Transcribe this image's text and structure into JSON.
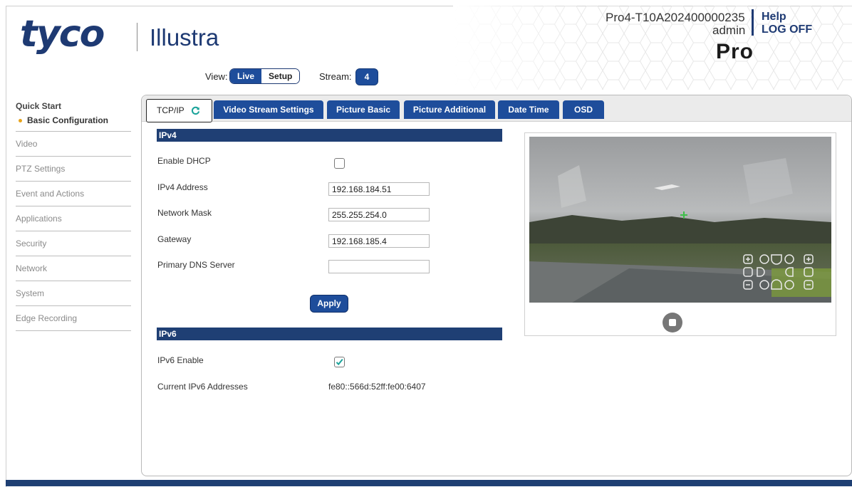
{
  "brand": {
    "logo_text": "tyco",
    "product_name": "Illustra",
    "model_label": "Pro"
  },
  "header": {
    "device_serial": "Pro4-T10A202400000235",
    "username": "admin",
    "help_label": "Help",
    "logoff_label": "LOG OFF"
  },
  "view_bar": {
    "view_label": "View:",
    "live_label": "Live",
    "setup_label": "Setup",
    "stream_label": "Stream:",
    "stream_value": "4"
  },
  "sidebar": {
    "quick_start": "Quick Start",
    "basic_configuration": "Basic Configuration",
    "items": [
      {
        "label": "Video"
      },
      {
        "label": "PTZ Settings"
      },
      {
        "label": "Event and Actions"
      },
      {
        "label": "Applications"
      },
      {
        "label": "Security"
      },
      {
        "label": "Network"
      },
      {
        "label": "System"
      },
      {
        "label": "Edge Recording"
      }
    ]
  },
  "tabs": [
    {
      "label": "TCP/IP",
      "active": true
    },
    {
      "label": "Video Stream Settings"
    },
    {
      "label": "Picture Basic"
    },
    {
      "label": "Picture Additional"
    },
    {
      "label": "Date Time"
    },
    {
      "label": "OSD"
    }
  ],
  "ipv4": {
    "section_title": "IPv4",
    "enable_dhcp_label": "Enable DHCP",
    "enable_dhcp_checked": false,
    "address_label": "IPv4 Address",
    "address_value": "192.168.184.51",
    "mask_label": "Network Mask",
    "mask_value": "255.255.254.0",
    "gateway_label": "Gateway",
    "gateway_value": "192.168.185.4",
    "dns_label": "Primary DNS Server",
    "dns_value": "",
    "apply_label": "Apply"
  },
  "ipv6": {
    "section_title": "IPv6",
    "enable_label": "IPv6 Enable",
    "enable_checked": true,
    "current_label": "Current IPv6 Addresses",
    "current_value": "fe80::566d:52ff:fe00:6407"
  },
  "colors": {
    "brand_blue": "#1e3a73",
    "button_blue": "#1e4d9b",
    "section_blue": "#1f3f74",
    "accent_orange": "#e8a41c"
  },
  "icons": [
    "refresh-icon",
    "checkmark-icon",
    "stop-icon",
    "zoom-in-icon",
    "zoom-out-icon",
    "ptz-arrow-icon",
    "crosshair-icon"
  ]
}
